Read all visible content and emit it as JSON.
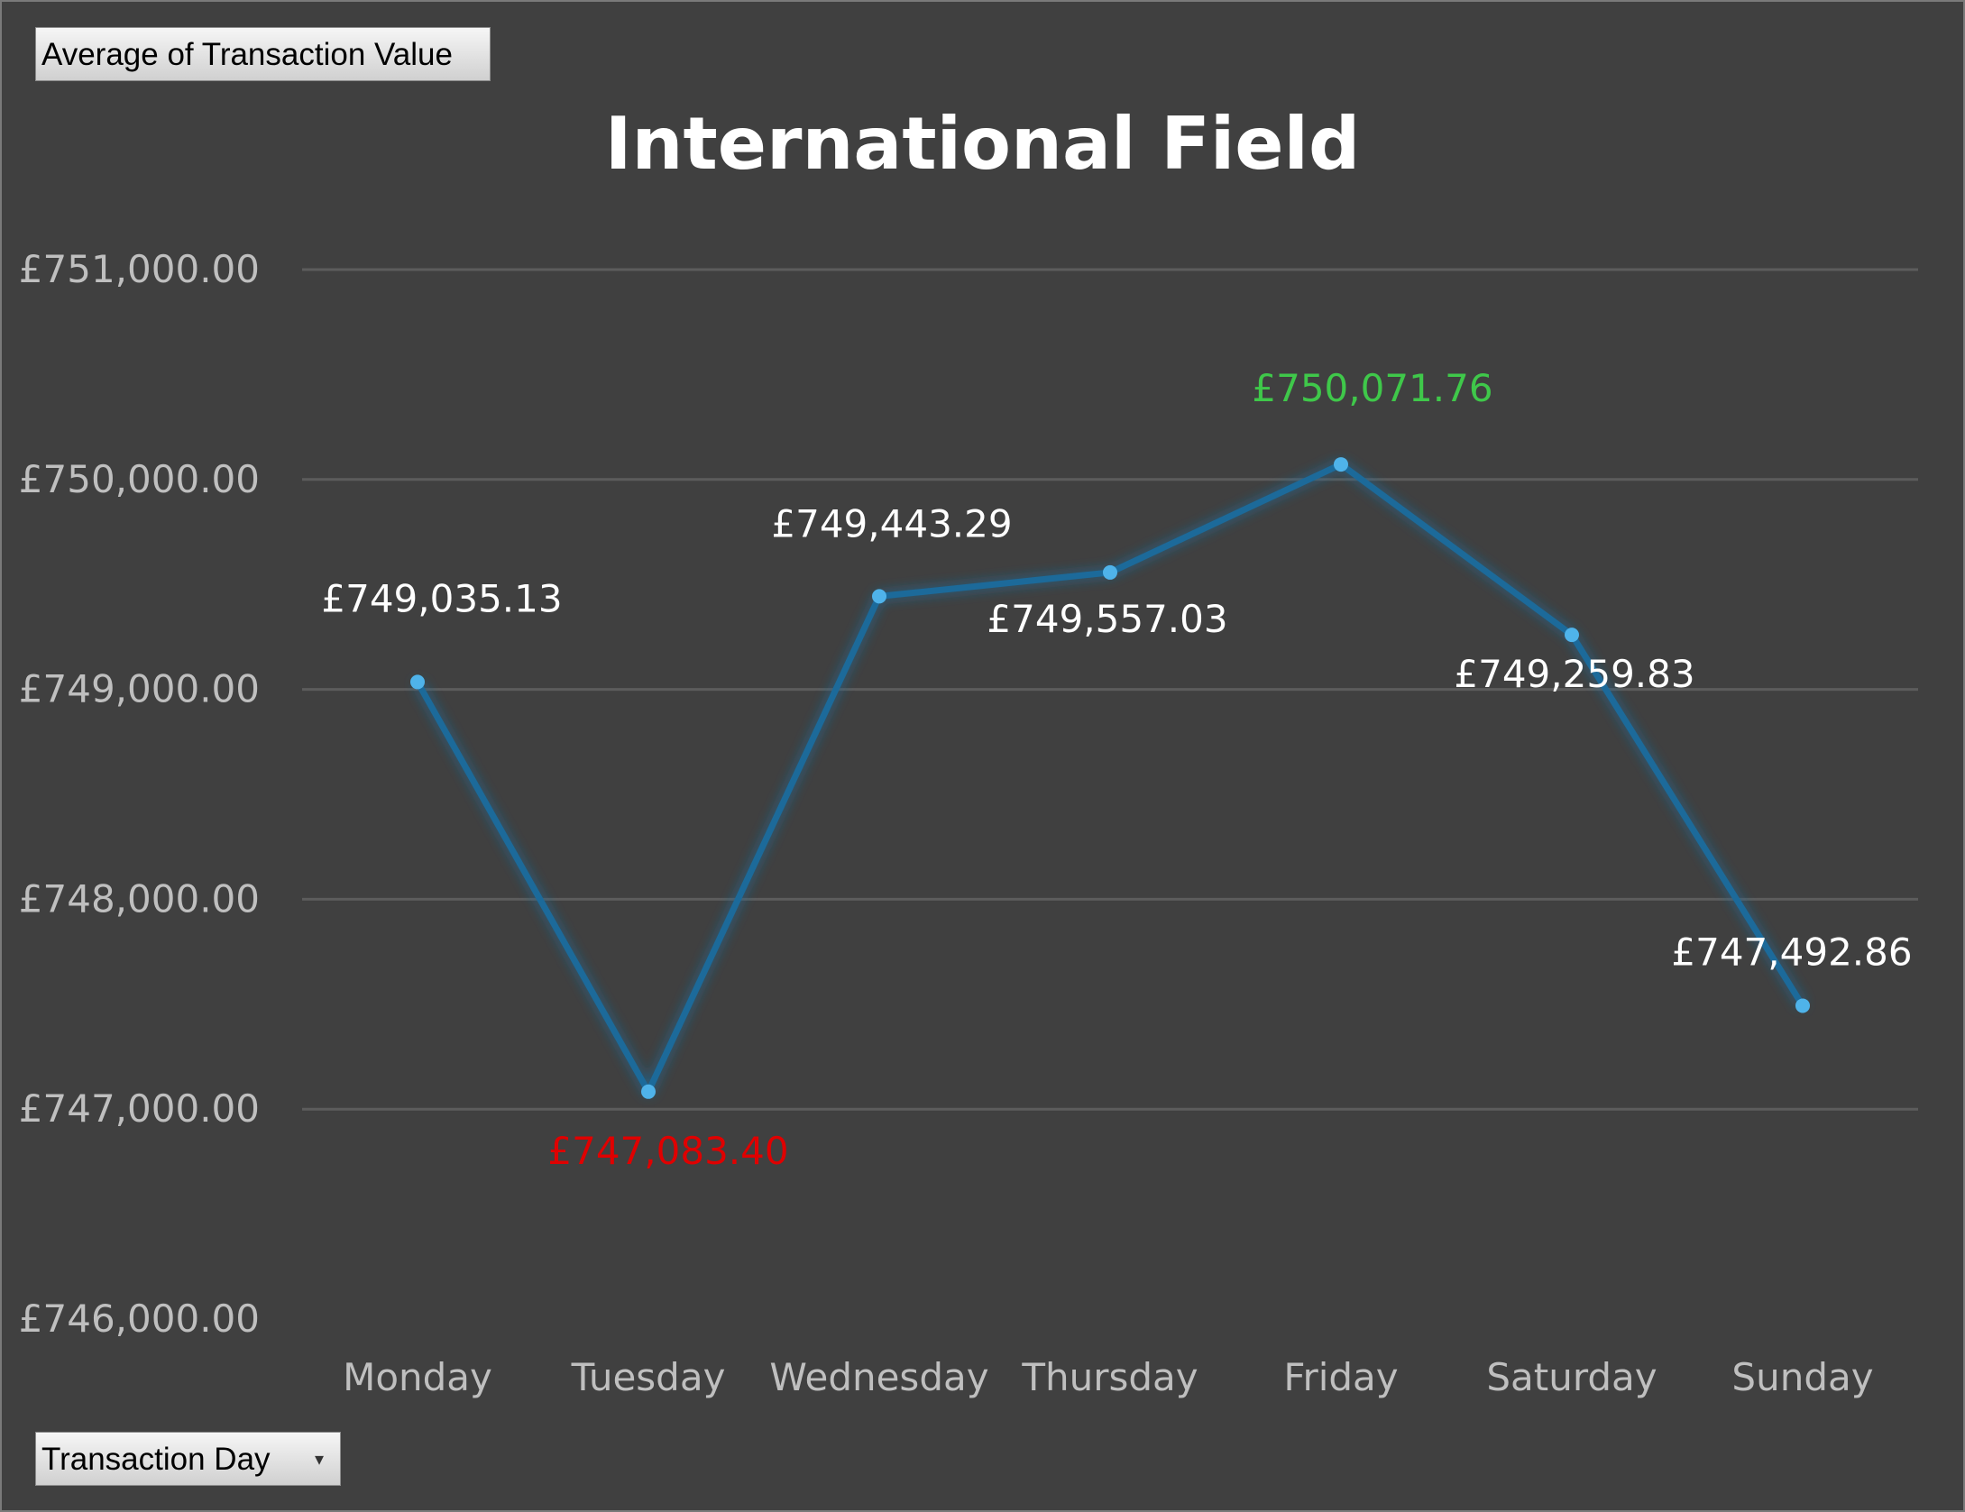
{
  "field_buttons": {
    "value_field": "Average  of Transaction Value",
    "axis_field": "Transaction  Day"
  },
  "colors": {
    "background": "#404040",
    "line": "#1c6a9a",
    "marker": "#4fb3ea",
    "label_default": "#ffffff",
    "label_max": "#3fc84a",
    "label_min": "#e00000",
    "axis_text": "#bfbfbf",
    "gridline": "#5c5c5c"
  },
  "chart_data": {
    "type": "line",
    "title": "International Field",
    "xlabel": "",
    "ylabel": "",
    "categories": [
      "Monday",
      "Tuesday",
      "Wednesday",
      "Thursday",
      "Friday",
      "Saturday",
      "Sunday"
    ],
    "series": [
      {
        "values": [
          749035.13,
          747083.4,
          749443.29,
          749557.03,
          750071.76,
          749259.83,
          747492.86
        ]
      }
    ],
    "data_labels": [
      "£749,035.13",
      "£747,083.40",
      "£749,443.29",
      "£749,557.03",
      "£750,071.76",
      "£749,259.83",
      "£747,492.86"
    ],
    "label_colors": [
      "default",
      "min",
      "default",
      "default",
      "max",
      "default",
      "default"
    ],
    "ylim": [
      746000,
      751000
    ],
    "y_ticks": [
      751000,
      750000,
      749000,
      748000,
      747000,
      746000
    ],
    "y_tick_labels": [
      "£751,000.00",
      "£750,000.00",
      "£749,000.00",
      "£748,000.00",
      "£747,000.00",
      "£746,000.00"
    ],
    "grid": true,
    "legend": "none"
  }
}
